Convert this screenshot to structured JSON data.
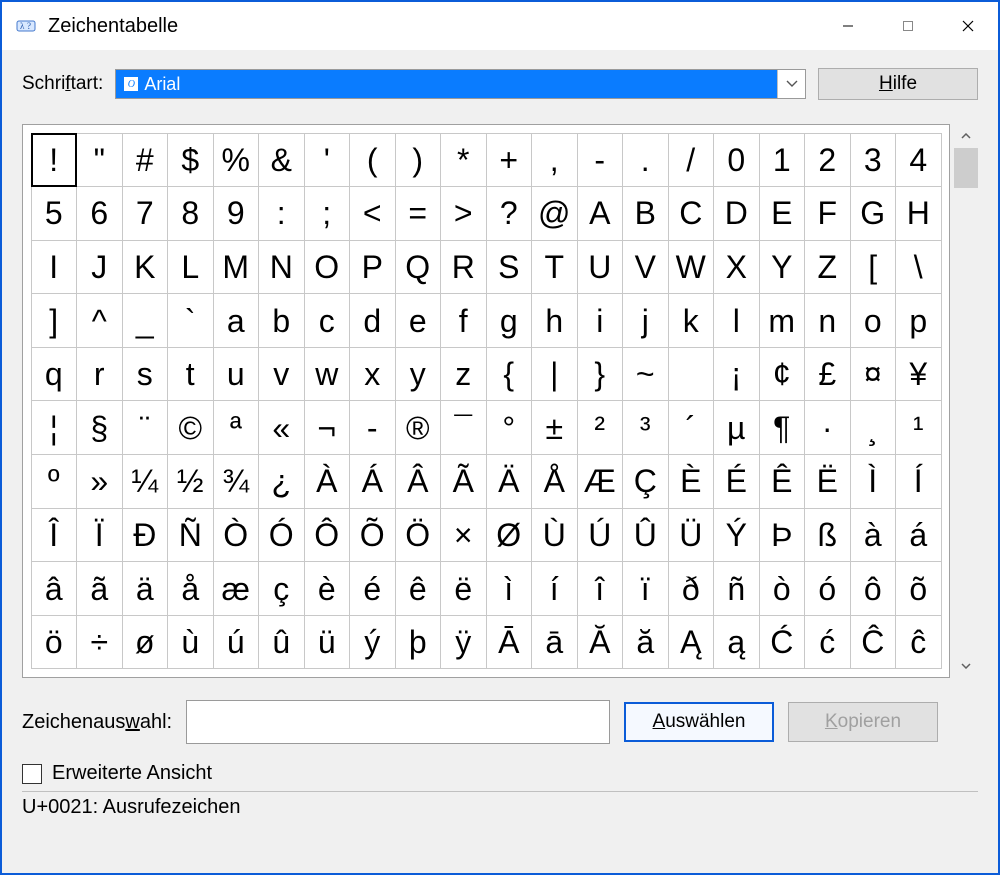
{
  "window": {
    "title": "Zeichentabelle"
  },
  "font_row": {
    "label_pre": "Schri",
    "label_ul": "f",
    "label_post": "tart:",
    "selected_font": "Arial"
  },
  "help_button": {
    "pre": "",
    "ul": "H",
    "post": "ilfe"
  },
  "char_grid": {
    "selected_index": 0,
    "chars": [
      "!",
      "\"",
      "#",
      "$",
      "%",
      "&",
      "'",
      "(",
      ")",
      "*",
      "+",
      ",",
      "-",
      ".",
      "/",
      "0",
      "1",
      "2",
      "3",
      "4",
      "5",
      "6",
      "7",
      "8",
      "9",
      ":",
      ";",
      "<",
      "=",
      ">",
      "?",
      "@",
      "A",
      "B",
      "C",
      "D",
      "E",
      "F",
      "G",
      "H",
      "I",
      "J",
      "K",
      "L",
      "M",
      "N",
      "O",
      "P",
      "Q",
      "R",
      "S",
      "T",
      "U",
      "V",
      "W",
      "X",
      "Y",
      "Z",
      "[",
      "\\",
      "]",
      "^",
      "_",
      "`",
      "a",
      "b",
      "c",
      "d",
      "e",
      "f",
      "g",
      "h",
      "i",
      "j",
      "k",
      "l",
      "m",
      "n",
      "o",
      "p",
      "q",
      "r",
      "s",
      "t",
      "u",
      "v",
      "w",
      "x",
      "y",
      "z",
      "{",
      "|",
      "}",
      "~",
      "",
      "¡",
      "¢",
      "£",
      "¤",
      "¥",
      "¦",
      "§",
      "¨",
      "©",
      "ª",
      "«",
      "¬",
      "-",
      "®",
      "¯",
      "°",
      "±",
      "²",
      "³",
      "´",
      "µ",
      "¶",
      "·",
      "¸",
      "¹",
      "º",
      "»",
      "¼",
      "½",
      "¾",
      "¿",
      "À",
      "Á",
      "Â",
      "Ã",
      "Ä",
      "Å",
      "Æ",
      "Ç",
      "È",
      "É",
      "Ê",
      "Ë",
      "Ì",
      "Í",
      "Î",
      "Ï",
      "Ð",
      "Ñ",
      "Ò",
      "Ó",
      "Ô",
      "Õ",
      "Ö",
      "×",
      "Ø",
      "Ù",
      "Ú",
      "Û",
      "Ü",
      "Ý",
      "Þ",
      "ß",
      "à",
      "á",
      "â",
      "ã",
      "ä",
      "å",
      "æ",
      "ç",
      "è",
      "é",
      "ê",
      "ë",
      "ì",
      "í",
      "î",
      "ï",
      "ð",
      "ñ",
      "ò",
      "ó",
      "ô",
      "õ",
      "ö",
      "÷",
      "ø",
      "ù",
      "ú",
      "û",
      "ü",
      "ý",
      "þ",
      "ÿ",
      "Ā",
      "ā",
      "Ă",
      "ă",
      "Ą",
      "ą",
      "Ć",
      "ć",
      "Ĉ",
      "ĉ"
    ]
  },
  "select_row": {
    "label_pre": "Zeichenaus",
    "label_ul": "w",
    "label_post": "ahl:",
    "value": ""
  },
  "select_button": {
    "pre": "",
    "ul": "A",
    "post": "uswählen"
  },
  "copy_button": {
    "pre": "",
    "ul": "K",
    "post": "opieren"
  },
  "advanced": {
    "checked": false,
    "label": "Erweiterte Ansicht"
  },
  "status": "U+0021: Ausrufezeichen"
}
